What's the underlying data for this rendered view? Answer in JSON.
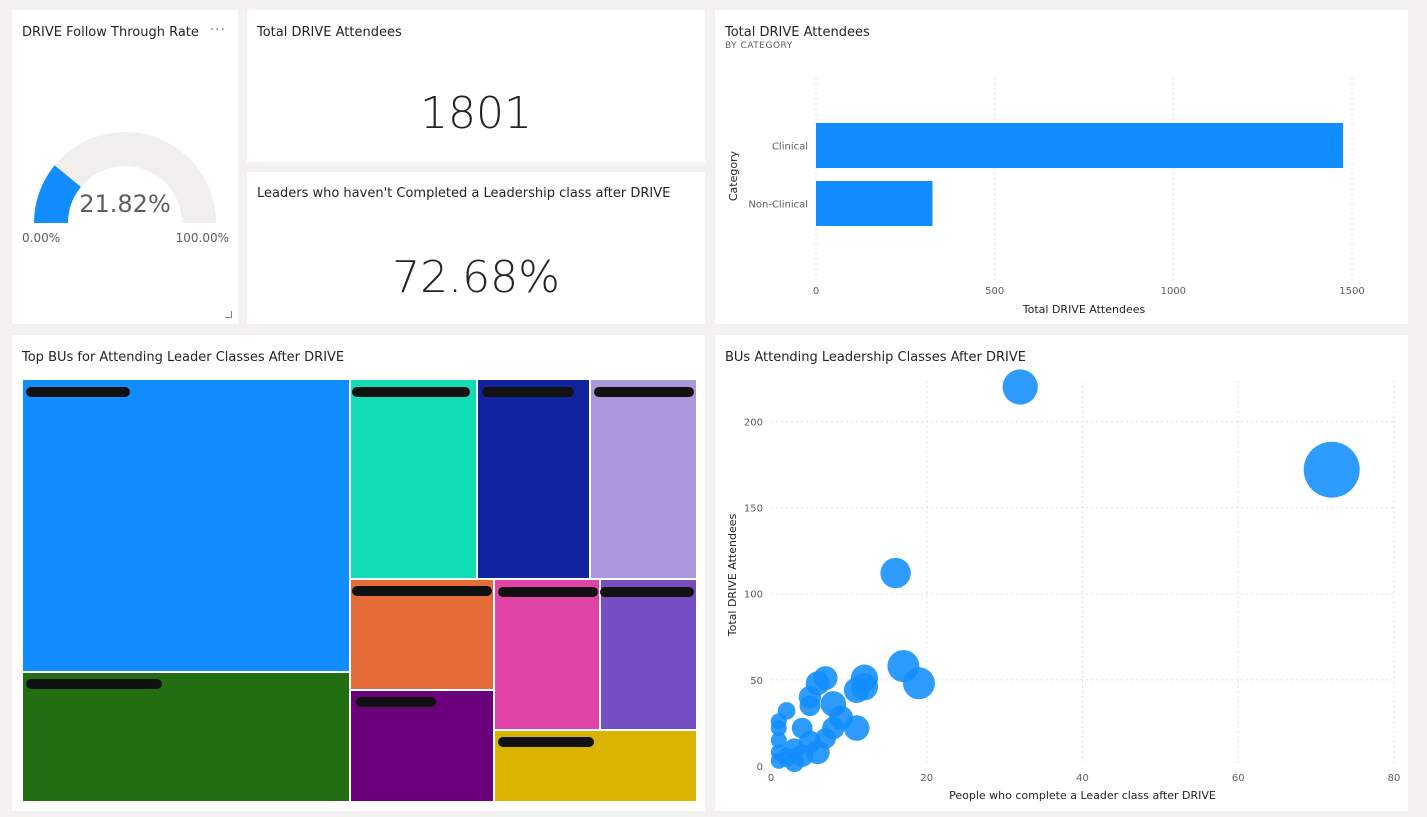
{
  "gauge_card": {
    "title": "DRIVE Follow Through Rate",
    "value_label": "21.82%",
    "min_label": "0.00%",
    "max_label": "100.00%",
    "value_fraction": 0.2182,
    "fill_color": "#118dff",
    "track_color": "#f0efee",
    "more_icon": "more-options-icon"
  },
  "kpi_attendees": {
    "title": "Total DRIVE Attendees",
    "value": "1801"
  },
  "kpi_leaders": {
    "title": "Leaders who haven't Completed a Leadership class after DRIVE",
    "value": "72.68%"
  },
  "category_chart": {
    "title": "Total DRIVE Attendees",
    "subtitle": "BY CATEGORY"
  },
  "treemap": {
    "title": "Top BUs for Attending Leader Classes After DRIVE",
    "cells": [
      {
        "color": "#118dff"
      },
      {
        "color": "#236d13"
      },
      {
        "color": "#12dcb3"
      },
      {
        "color": "#12239e"
      },
      {
        "color": "#ab97dc"
      },
      {
        "color": "#e66c37"
      },
      {
        "color": "#e044a7"
      },
      {
        "color": "#744ec2"
      },
      {
        "color": "#6b007b"
      },
      {
        "color": "#d9b300"
      }
    ]
  },
  "scatter_chart": {
    "title": "BUs Attending Leadership Classes After DRIVE"
  },
  "chart_data": [
    {
      "type": "bar",
      "orientation": "horizontal",
      "title": "Total DRIVE Attendees",
      "subtitle": "BY CATEGORY",
      "categories": [
        "Clinical",
        "Non-Clinical"
      ],
      "values": [
        1475,
        326
      ],
      "xlabel": "Total DRIVE Attendees",
      "ylabel": "Category",
      "xlim": [
        0,
        1500
      ],
      "xticks": [
        "0",
        "500",
        "1000",
        "1500"
      ],
      "grid": true,
      "color": "#118dff"
    },
    {
      "type": "scatter",
      "title": "BUs Attending Leadership Classes After DRIVE",
      "xlabel": "People who complete a Leader class after DRIVE",
      "ylabel": "Total DRIVE Attendees",
      "xlim": [
        0,
        80
      ],
      "ylim": [
        0,
        220
      ],
      "xticks": [
        "0",
        "20",
        "40",
        "60",
        "80"
      ],
      "yticks": [
        "0",
        "50",
        "100",
        "150",
        "200"
      ],
      "grid": true,
      "color": "#118dff",
      "points": [
        {
          "x": 32,
          "y": 220,
          "size": 2.2
        },
        {
          "x": 72,
          "y": 172,
          "size": 3.5
        },
        {
          "x": 16,
          "y": 112,
          "size": 1.9
        },
        {
          "x": 17,
          "y": 58,
          "size": 2.0
        },
        {
          "x": 19,
          "y": 48,
          "size": 2.0
        },
        {
          "x": 12,
          "y": 51,
          "size": 1.7
        },
        {
          "x": 12,
          "y": 46,
          "size": 1.7
        },
        {
          "x": 11,
          "y": 44,
          "size": 1.6
        },
        {
          "x": 11,
          "y": 22,
          "size": 1.6
        },
        {
          "x": 7,
          "y": 51,
          "size": 1.5
        },
        {
          "x": 6,
          "y": 48,
          "size": 1.5
        },
        {
          "x": 8,
          "y": 36,
          "size": 1.6
        },
        {
          "x": 5,
          "y": 40,
          "size": 1.4
        },
        {
          "x": 5,
          "y": 35,
          "size": 1.3
        },
        {
          "x": 9,
          "y": 28,
          "size": 1.5
        },
        {
          "x": 8,
          "y": 22,
          "size": 1.4
        },
        {
          "x": 7,
          "y": 16,
          "size": 1.3
        },
        {
          "x": 4,
          "y": 22,
          "size": 1.3
        },
        {
          "x": 2,
          "y": 32,
          "size": 1.1
        },
        {
          "x": 1,
          "y": 26,
          "size": 1.0
        },
        {
          "x": 1,
          "y": 22,
          "size": 1.0
        },
        {
          "x": 1,
          "y": 15,
          "size": 1.0
        },
        {
          "x": 1,
          "y": 8,
          "size": 1.0
        },
        {
          "x": 1,
          "y": 3,
          "size": 1.0
        },
        {
          "x": 2,
          "y": 5,
          "size": 1.2
        },
        {
          "x": 3,
          "y": 10,
          "size": 1.3
        },
        {
          "x": 4,
          "y": 6,
          "size": 1.4
        },
        {
          "x": 5,
          "y": 14,
          "size": 1.4
        },
        {
          "x": 6,
          "y": 8,
          "size": 1.5
        },
        {
          "x": 3,
          "y": 2,
          "size": 1.2
        }
      ]
    }
  ]
}
